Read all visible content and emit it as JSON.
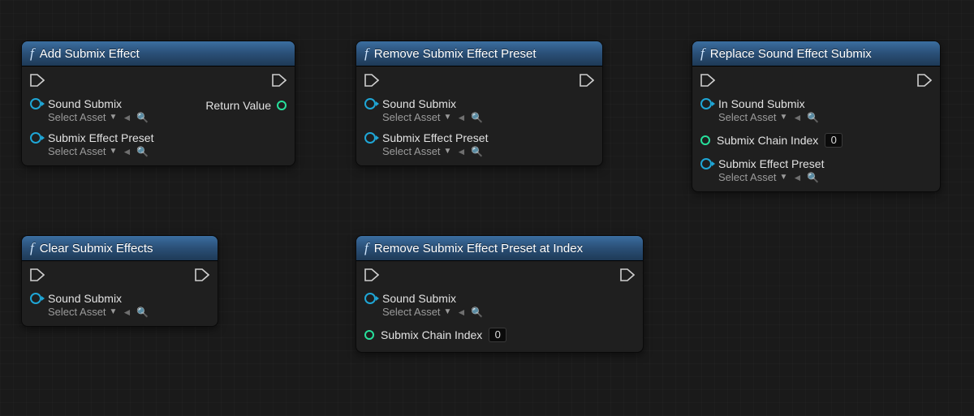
{
  "common": {
    "select_asset": "Select Asset"
  },
  "nodes": {
    "addSubmixEffect": {
      "title": "Add Submix Effect",
      "soundSubmix": "Sound Submix",
      "submixEffectPreset": "Submix Effect Preset",
      "returnValue": "Return Value"
    },
    "clearSubmixEffects": {
      "title": "Clear Submix Effects",
      "soundSubmix": "Sound Submix"
    },
    "removeSubmixEffectPreset": {
      "title": "Remove Submix Effect Preset",
      "soundSubmix": "Sound Submix",
      "submixEffectPreset": "Submix Effect Preset"
    },
    "removeSubmixEffectPresetAtIndex": {
      "title": "Remove Submix Effect Preset at Index",
      "soundSubmix": "Sound Submix",
      "submixChainIndex": "Submix Chain Index",
      "submixChainIndexValue": "0"
    },
    "replaceSoundEffectSubmix": {
      "title": "Replace Sound Effect Submix",
      "inSoundSubmix": "In Sound Submix",
      "submixChainIndex": "Submix Chain Index",
      "submixChainIndexValue": "0",
      "submixEffectPreset": "Submix Effect Preset"
    }
  }
}
